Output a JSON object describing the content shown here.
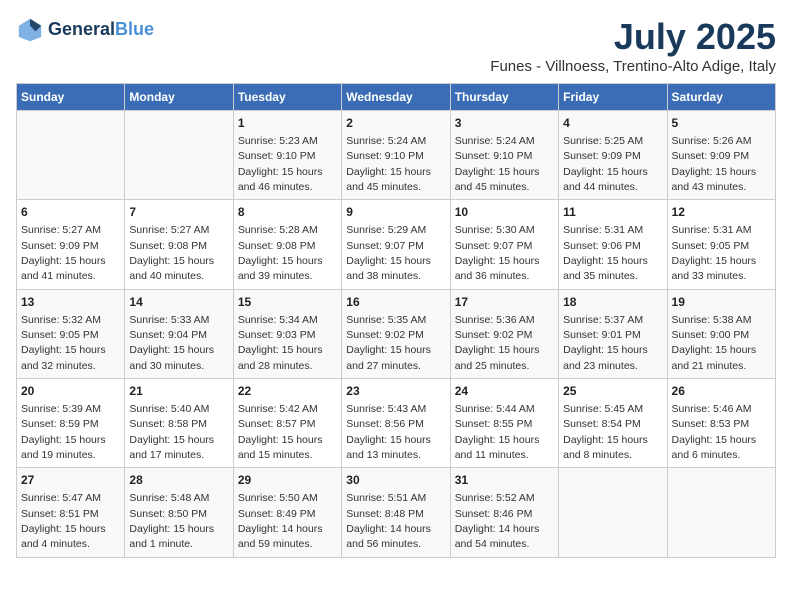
{
  "header": {
    "logo_line1": "General",
    "logo_line2": "Blue",
    "title": "July 2025",
    "subtitle": "Funes - Villnoess, Trentino-Alto Adige, Italy"
  },
  "columns": [
    "Sunday",
    "Monday",
    "Tuesday",
    "Wednesday",
    "Thursday",
    "Friday",
    "Saturday"
  ],
  "weeks": [
    [
      {
        "day": "",
        "text": ""
      },
      {
        "day": "",
        "text": ""
      },
      {
        "day": "1",
        "text": "Sunrise: 5:23 AM\nSunset: 9:10 PM\nDaylight: 15 hours\nand 46 minutes."
      },
      {
        "day": "2",
        "text": "Sunrise: 5:24 AM\nSunset: 9:10 PM\nDaylight: 15 hours\nand 45 minutes."
      },
      {
        "day": "3",
        "text": "Sunrise: 5:24 AM\nSunset: 9:10 PM\nDaylight: 15 hours\nand 45 minutes."
      },
      {
        "day": "4",
        "text": "Sunrise: 5:25 AM\nSunset: 9:09 PM\nDaylight: 15 hours\nand 44 minutes."
      },
      {
        "day": "5",
        "text": "Sunrise: 5:26 AM\nSunset: 9:09 PM\nDaylight: 15 hours\nand 43 minutes."
      }
    ],
    [
      {
        "day": "6",
        "text": "Sunrise: 5:27 AM\nSunset: 9:09 PM\nDaylight: 15 hours\nand 41 minutes."
      },
      {
        "day": "7",
        "text": "Sunrise: 5:27 AM\nSunset: 9:08 PM\nDaylight: 15 hours\nand 40 minutes."
      },
      {
        "day": "8",
        "text": "Sunrise: 5:28 AM\nSunset: 9:08 PM\nDaylight: 15 hours\nand 39 minutes."
      },
      {
        "day": "9",
        "text": "Sunrise: 5:29 AM\nSunset: 9:07 PM\nDaylight: 15 hours\nand 38 minutes."
      },
      {
        "day": "10",
        "text": "Sunrise: 5:30 AM\nSunset: 9:07 PM\nDaylight: 15 hours\nand 36 minutes."
      },
      {
        "day": "11",
        "text": "Sunrise: 5:31 AM\nSunset: 9:06 PM\nDaylight: 15 hours\nand 35 minutes."
      },
      {
        "day": "12",
        "text": "Sunrise: 5:31 AM\nSunset: 9:05 PM\nDaylight: 15 hours\nand 33 minutes."
      }
    ],
    [
      {
        "day": "13",
        "text": "Sunrise: 5:32 AM\nSunset: 9:05 PM\nDaylight: 15 hours\nand 32 minutes."
      },
      {
        "day": "14",
        "text": "Sunrise: 5:33 AM\nSunset: 9:04 PM\nDaylight: 15 hours\nand 30 minutes."
      },
      {
        "day": "15",
        "text": "Sunrise: 5:34 AM\nSunset: 9:03 PM\nDaylight: 15 hours\nand 28 minutes."
      },
      {
        "day": "16",
        "text": "Sunrise: 5:35 AM\nSunset: 9:02 PM\nDaylight: 15 hours\nand 27 minutes."
      },
      {
        "day": "17",
        "text": "Sunrise: 5:36 AM\nSunset: 9:02 PM\nDaylight: 15 hours\nand 25 minutes."
      },
      {
        "day": "18",
        "text": "Sunrise: 5:37 AM\nSunset: 9:01 PM\nDaylight: 15 hours\nand 23 minutes."
      },
      {
        "day": "19",
        "text": "Sunrise: 5:38 AM\nSunset: 9:00 PM\nDaylight: 15 hours\nand 21 minutes."
      }
    ],
    [
      {
        "day": "20",
        "text": "Sunrise: 5:39 AM\nSunset: 8:59 PM\nDaylight: 15 hours\nand 19 minutes."
      },
      {
        "day": "21",
        "text": "Sunrise: 5:40 AM\nSunset: 8:58 PM\nDaylight: 15 hours\nand 17 minutes."
      },
      {
        "day": "22",
        "text": "Sunrise: 5:42 AM\nSunset: 8:57 PM\nDaylight: 15 hours\nand 15 minutes."
      },
      {
        "day": "23",
        "text": "Sunrise: 5:43 AM\nSunset: 8:56 PM\nDaylight: 15 hours\nand 13 minutes."
      },
      {
        "day": "24",
        "text": "Sunrise: 5:44 AM\nSunset: 8:55 PM\nDaylight: 15 hours\nand 11 minutes."
      },
      {
        "day": "25",
        "text": "Sunrise: 5:45 AM\nSunset: 8:54 PM\nDaylight: 15 hours\nand 8 minutes."
      },
      {
        "day": "26",
        "text": "Sunrise: 5:46 AM\nSunset: 8:53 PM\nDaylight: 15 hours\nand 6 minutes."
      }
    ],
    [
      {
        "day": "27",
        "text": "Sunrise: 5:47 AM\nSunset: 8:51 PM\nDaylight: 15 hours\nand 4 minutes."
      },
      {
        "day": "28",
        "text": "Sunrise: 5:48 AM\nSunset: 8:50 PM\nDaylight: 15 hours\nand 1 minute."
      },
      {
        "day": "29",
        "text": "Sunrise: 5:50 AM\nSunset: 8:49 PM\nDaylight: 14 hours\nand 59 minutes."
      },
      {
        "day": "30",
        "text": "Sunrise: 5:51 AM\nSunset: 8:48 PM\nDaylight: 14 hours\nand 56 minutes."
      },
      {
        "day": "31",
        "text": "Sunrise: 5:52 AM\nSunset: 8:46 PM\nDaylight: 14 hours\nand 54 minutes."
      },
      {
        "day": "",
        "text": ""
      },
      {
        "day": "",
        "text": ""
      }
    ]
  ]
}
